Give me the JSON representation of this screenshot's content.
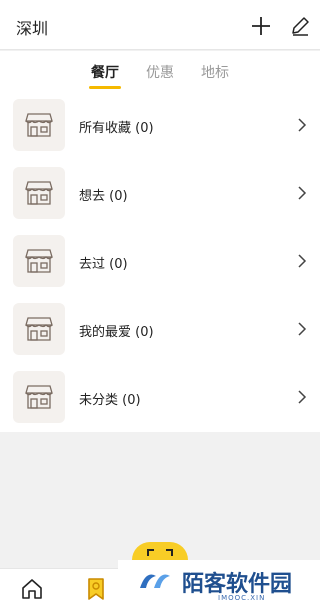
{
  "header": {
    "city": "深圳",
    "icons": [
      "plus-icon",
      "edit-icon"
    ]
  },
  "tabs": [
    {
      "label": "餐厅",
      "active": true
    },
    {
      "label": "优惠",
      "active": false
    },
    {
      "label": "地标",
      "active": false
    }
  ],
  "accent_color": "#f5b900",
  "collections": [
    {
      "label": "所有收藏 (0)"
    },
    {
      "label": "想去 (0)"
    },
    {
      "label": "去过 (0)"
    },
    {
      "label": "我的最爱 (0)"
    },
    {
      "label": "未分类 (0)"
    }
  ],
  "bottom_nav": {
    "icons": [
      "home-icon",
      "bookmark-icon",
      "scan-icon"
    ]
  },
  "watermark": {
    "title": "陌客软件园",
    "subtitle": "IMOOC.XIN"
  }
}
